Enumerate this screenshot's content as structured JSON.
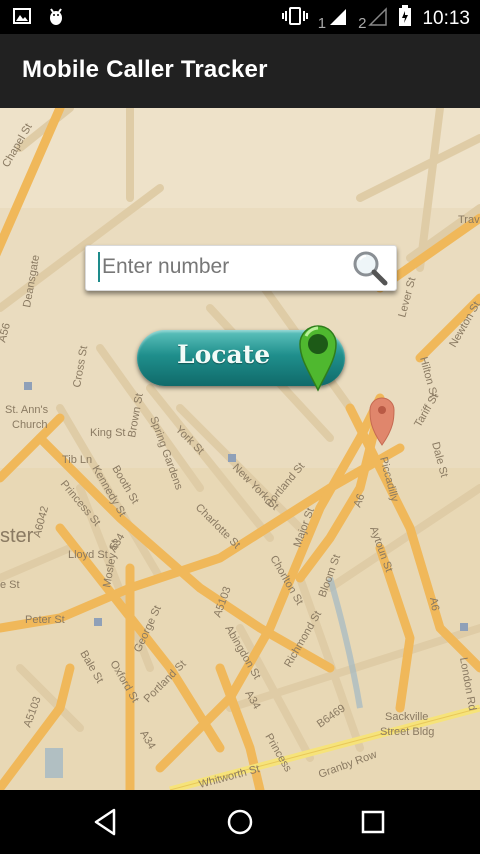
{
  "status_bar": {
    "time": "10:13",
    "sim1_label": "1",
    "sim2_label": "2",
    "icons": [
      "image-icon",
      "android-debug-icon",
      "vibrate-icon",
      "signal-icon",
      "signal-icon",
      "battery-icon"
    ]
  },
  "app_bar": {
    "title": "Mobile Caller Tracker"
  },
  "search": {
    "placeholder": "Enter number",
    "value": "",
    "icon": "magnifier-icon"
  },
  "locate_button": {
    "label": "Locate",
    "pin_icon": "map-pin-icon"
  },
  "map": {
    "labels": [
      "Chapel St",
      "Deansgate",
      "St. Ann's Church",
      "King St",
      "Tib Ln",
      "Cross St",
      "Brown St",
      "York St",
      "Spring Gardens",
      "Booth St",
      "Kennedy St",
      "Princess St",
      "Lloyd St",
      "Peter St",
      "Mosley St",
      "George St",
      "Charlotte St",
      "New York St",
      "Portland St",
      "Oxford St",
      "Bale St",
      "A5103",
      "A34",
      "A6042",
      "A56",
      "Abingdon St",
      "Chorlton St",
      "Major St",
      "Bloom St",
      "Richmond St",
      "A6",
      "Aytoun St",
      "Piccadilly",
      "Tariff St",
      "Dale St",
      "Hilton St",
      "Lever St",
      "Newton St",
      "London Rd",
      "Sackville Street Bldg",
      "Granby Row",
      "Whitworth St",
      "B6469",
      "Travelo",
      "ster",
      "e St"
    ],
    "marker_icon": "map-marker-icon",
    "colors": {
      "land": "#eadcbf",
      "road": "#f0b85a",
      "minor_road": "#ddc8a0"
    }
  },
  "nav_bar": {
    "icons": [
      "back-icon",
      "home-icon",
      "recents-icon"
    ]
  }
}
